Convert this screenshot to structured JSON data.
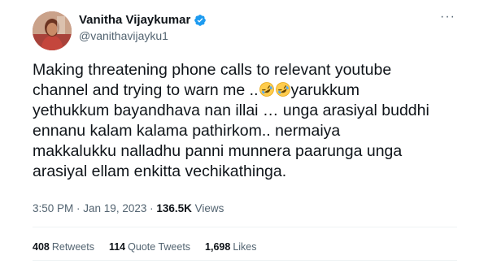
{
  "author": {
    "display_name": "Vanitha Vijaykumar",
    "handle": "@vanithavijayku1",
    "verified": true
  },
  "tweet": {
    "line1": "Making threatening phone calls to relevant youtube",
    "line2_a": "channel and trying to warn me ..",
    "line2_b": "yarukkum",
    "line3": "yethukkum bayandhava nan illai … unga arasiyal buddhi",
    "line4": "ennanu kalam kalama pathirkom.. nermaiya",
    "line5": "makkalukku nalladhu panni munnera paarunga unga",
    "line6": "arasiyal ellam enkitta vechikathinga.",
    "emojis": [
      "rolling-on-floor-laughing",
      "rolling-on-floor-laughing"
    ]
  },
  "meta": {
    "time": "3:50 PM",
    "separator": " · ",
    "date": "Jan 19, 2023",
    "views_count": "136.5K",
    "views_label": " Views"
  },
  "stats": {
    "retweets_count": "408",
    "retweets_label": "Retweets",
    "quotes_count": "114",
    "quotes_label": "Quote Tweets",
    "likes_count": "1,698",
    "likes_label": "Likes"
  },
  "more_label": "···",
  "colors": {
    "text": "#0f1419",
    "secondary": "#536471",
    "verified": "#1d9bf0",
    "divider": "#eff3f4"
  }
}
